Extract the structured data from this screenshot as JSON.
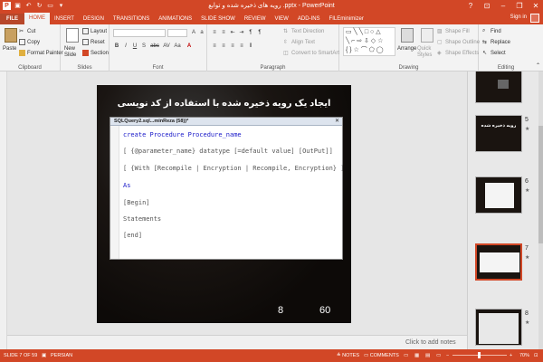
{
  "window": {
    "title": "رویه های ذخیره شده و توابع .pptx - PowerPoint",
    "help_label": "?",
    "minimize_label": "–",
    "restore_label": "❐",
    "close_label": "✕"
  },
  "tabs": [
    {
      "label": "FILE"
    },
    {
      "label": "HOME"
    },
    {
      "label": "INSERT"
    },
    {
      "label": "DESIGN"
    },
    {
      "label": "TRANSITIONS"
    },
    {
      "label": "ANIMATIONS"
    },
    {
      "label": "SLIDE SHOW"
    },
    {
      "label": "REVIEW"
    },
    {
      "label": "VIEW"
    },
    {
      "label": "ADD-INS"
    },
    {
      "label": "FILEminimizer"
    }
  ],
  "account": {
    "signin_label": "Sign in"
  },
  "ribbon": {
    "clipboard": {
      "label": "Clipboard",
      "paste": "Paste",
      "cut": "Cut",
      "copy": "Copy",
      "format_painter": "Format Painter"
    },
    "slides": {
      "label": "Slides",
      "new_slide": "New Slide",
      "layout": "Layout",
      "reset": "Reset",
      "section": "Section"
    },
    "font": {
      "label": "Font",
      "buttons": [
        "B",
        "I",
        "U",
        "S",
        "abc",
        "AV",
        "Aa",
        "A"
      ]
    },
    "paragraph": {
      "label": "Paragraph",
      "text_direction": "Text Direction",
      "align_text": "Align Text",
      "convert_smartart": "Convert to SmartArt"
    },
    "drawing": {
      "label": "Drawing",
      "arrange": "Arrange",
      "quick_styles": "Quick Styles",
      "shape_fill": "Shape Fill",
      "shape_outline": "Shape Outline",
      "shape_effects": "Shape Effects"
    },
    "editing": {
      "label": "Editing",
      "find": "Find",
      "replace": "Replace",
      "select": "Select"
    }
  },
  "slide": {
    "title": "ایجاد یک رویه ذخیره شده با استفاده از کد نویسی",
    "sql_window_title": "SQLQuery2.sql...minReza (58))*",
    "code_lines": [
      {
        "kw": "create Procedure Procedure_name",
        "rest": ""
      },
      {
        "kw": "",
        "rest": "[ {@parameter_name} datatype [=default value] [OutPut]]"
      },
      {
        "kw": "",
        "rest": "[ {With [Recompile | Encryption | Recompile, Encryption} ]"
      },
      {
        "kw": "As",
        "rest": ""
      },
      {
        "kw": "",
        "rest": "[Begin]"
      },
      {
        "kw": "",
        "rest": "Statements"
      },
      {
        "kw": "",
        "rest": "[end]"
      }
    ],
    "footer_left": "8",
    "footer_right": "60"
  },
  "notes": {
    "placeholder": "Click to add notes"
  },
  "thumbnails": [
    {
      "number": "",
      "caption": ""
    },
    {
      "number": "5",
      "caption": "رویه ذخیره شده"
    },
    {
      "number": "6",
      "caption": ""
    },
    {
      "number": "7",
      "caption": ""
    },
    {
      "number": "8",
      "caption": ""
    }
  ],
  "statusbar": {
    "slide_info": "SLIDE 7 OF 59",
    "language": "PERSIAN",
    "notes": "NOTES",
    "comments": "COMMENTS",
    "zoom": "70%"
  }
}
